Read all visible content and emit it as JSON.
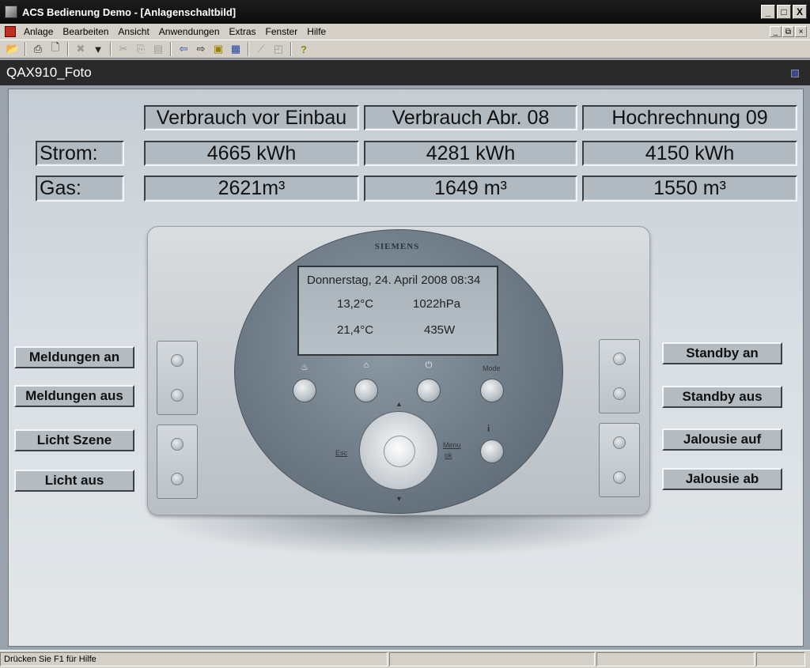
{
  "window": {
    "title": "ACS Bedienung Demo - [Anlagenschaltbild]",
    "buttons": [
      "_",
      "□",
      "X"
    ]
  },
  "menu": {
    "items": [
      {
        "label": "Anlage"
      },
      {
        "label": "Bearbeiten"
      },
      {
        "label": "Ansicht"
      },
      {
        "label": "Anwendungen"
      },
      {
        "label": "Extras"
      },
      {
        "label": "Fenster"
      },
      {
        "label": "Hilfe"
      }
    ],
    "mdi_buttons": [
      "_",
      "⧉",
      "×"
    ]
  },
  "toolbar": {
    "icons": [
      "open-folder-icon",
      "print-icon",
      "print-preview-icon",
      "delete-icon",
      "filter-icon",
      "cut-icon",
      "copy-icon",
      "paste-icon",
      "back-arrow-icon",
      "forward-arrow-icon",
      "folder-up-icon",
      "window-icon",
      "connect-icon",
      "disconnect-icon",
      "help-icon"
    ]
  },
  "document": {
    "title": "QAX910_Foto"
  },
  "consumption": {
    "headers": [
      "Verbrauch vor Einbau",
      "Verbrauch Abr. 08",
      "Hochrechnung 09"
    ],
    "rows": [
      {
        "label": "Strom:",
        "values": [
          "4665 kWh",
          "4281 kWh",
          "4150 kWh"
        ]
      },
      {
        "label": "Gas:",
        "values": [
          "2621m³",
          "1649 m³",
          "1550 m³"
        ]
      }
    ]
  },
  "device": {
    "brand": "SIEMENS",
    "lcd": {
      "datetime": "Donnerstag, 24. April 2008 08:34",
      "temp1": "13,2°C",
      "pressure": "1022hPa",
      "temp2": "21,4°C",
      "power": "435W"
    },
    "mode_label": "Mode",
    "esc_label": "Esc",
    "menu_label": "Menu",
    "ok_label": "ok",
    "info_label": "i"
  },
  "actions": {
    "left": [
      "Meldungen an",
      "Meldungen aus",
      "Licht Szene",
      "Licht aus"
    ],
    "right": [
      "Standby an",
      "Standby aus",
      "Jalousie auf",
      "Jalousie ab"
    ]
  },
  "status": {
    "text": "Drücken Sie F1 für Hilfe"
  }
}
